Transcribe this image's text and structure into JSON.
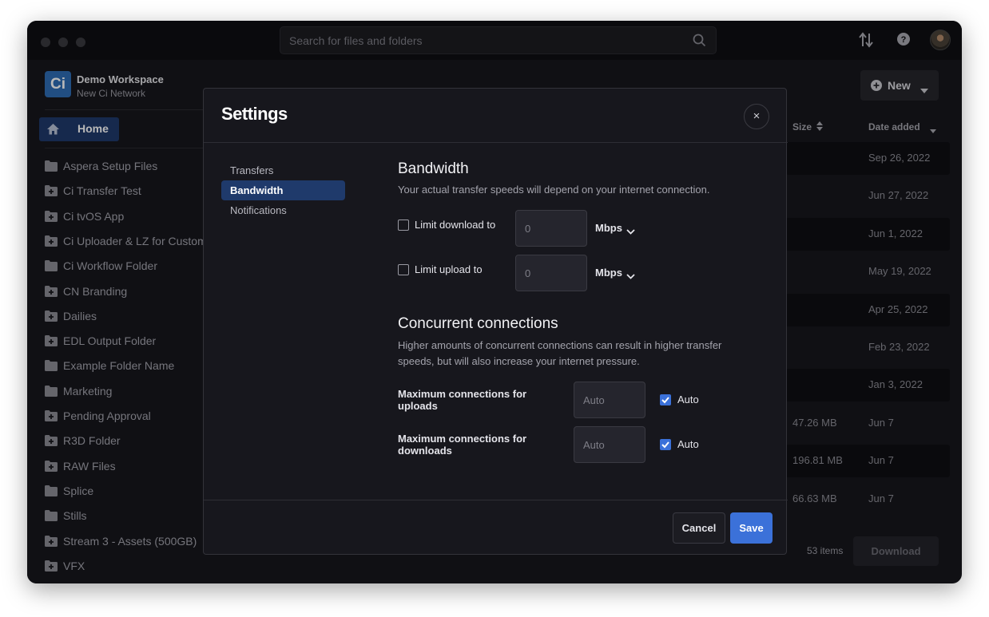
{
  "search": {
    "placeholder": "Search for files and folders"
  },
  "workspace": {
    "logo": "Ci",
    "name": "Demo Workspace",
    "network": "New Ci Network"
  },
  "sidebar": {
    "home_label": "Home",
    "folders": [
      {
        "label": "Aspera Setup Files",
        "icon": "folder-icon"
      },
      {
        "label": "Ci Transfer Test",
        "icon": "shared-folder-icon"
      },
      {
        "label": "Ci tvOS App",
        "icon": "shared-folder-icon"
      },
      {
        "label": "Ci Uploader & LZ for Customers",
        "icon": "shared-folder-icon"
      },
      {
        "label": "Ci Workflow Folder",
        "icon": "folder-icon"
      },
      {
        "label": "CN Branding",
        "icon": "shared-folder-icon"
      },
      {
        "label": "Dailies",
        "icon": "shared-folder-icon"
      },
      {
        "label": "EDL Output Folder",
        "icon": "shared-folder-icon"
      },
      {
        "label": "Example Folder Name",
        "icon": "folder-icon"
      },
      {
        "label": "Marketing",
        "icon": "folder-icon"
      },
      {
        "label": "Pending Approval",
        "icon": "shared-folder-icon"
      },
      {
        "label": "R3D Folder",
        "icon": "shared-folder-icon"
      },
      {
        "label": "RAW Files",
        "icon": "shared-folder-icon"
      },
      {
        "label": "Splice",
        "icon": "folder-icon"
      },
      {
        "label": "Stills",
        "icon": "folder-icon"
      },
      {
        "label": "Stream 3 - Assets (500GB)",
        "icon": "shared-folder-icon"
      },
      {
        "label": "VFX",
        "icon": "shared-folder-icon"
      }
    ]
  },
  "toolbar": {
    "new_label": "New"
  },
  "table": {
    "col_size": "Size",
    "col_date": "Date added",
    "rows": [
      {
        "size": "",
        "date": "Sep 26, 2022"
      },
      {
        "size": "",
        "date": "Jun 27, 2022"
      },
      {
        "size": "",
        "date": "Jun 1, 2022"
      },
      {
        "size": "",
        "date": "May 19, 2022"
      },
      {
        "size": "",
        "date": "Apr 25, 2022"
      },
      {
        "size": "",
        "date": "Feb 23, 2022"
      },
      {
        "size": "",
        "date": "Jan 3, 2022"
      },
      {
        "size": "47.26 MB",
        "date": "Jun 7"
      },
      {
        "size": "196.81 MB",
        "date": "Jun 7"
      },
      {
        "size": "66.63 MB",
        "date": "Jun 7"
      }
    ],
    "item_count": "53 items",
    "download_label": "Download"
  },
  "modal": {
    "title": "Settings",
    "close": "×",
    "nav": [
      "Transfers",
      "Bandwidth",
      "Notifications"
    ],
    "active_nav": "Bandwidth",
    "bandwidth_heading": "Bandwidth",
    "bandwidth_desc": "Your actual transfer speeds will depend on your internet connection.",
    "limit_download_label": "Limit download to",
    "limit_download_value": "0",
    "limit_upload_label": "Limit upload to",
    "limit_upload_value": "0",
    "unit": "Mbps",
    "concurrent_heading": "Concurrent connections",
    "concurrent_desc": "Higher amounts of concurrent connections can result in higher transfer speeds, but will also increase your internet pressure.",
    "max_uploads_label": "Maximum connections for uploads",
    "max_uploads_value": "Auto",
    "max_downloads_label": "Maximum connections for downloads",
    "max_downloads_value": "Auto",
    "auto_label": "Auto",
    "cancel": "Cancel",
    "save": "Save"
  },
  "colors": {
    "accent": "#3b71d9",
    "nav_active": "#1f3a6b",
    "window_bg": "#17171c"
  }
}
